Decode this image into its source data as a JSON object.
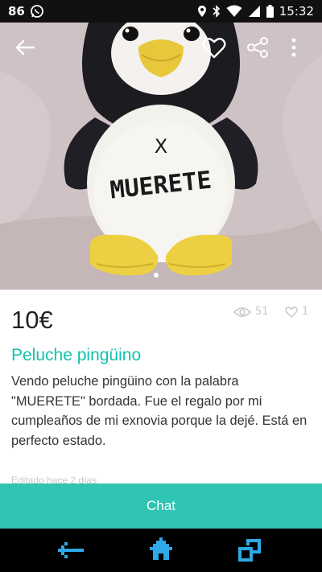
{
  "status_bar": {
    "notification_count": "86",
    "time": "15:32",
    "icons": [
      "whatsapp-icon",
      "location-icon",
      "bluetooth-icon",
      "wifi-icon",
      "signal-icon",
      "battery-icon"
    ]
  },
  "toolbar": {
    "icons": [
      "back-arrow-icon",
      "heart-icon",
      "share-icon",
      "more-vertical-icon"
    ]
  },
  "photo": {
    "embroidery_mark": "X",
    "embroidery_text": "MUERETE"
  },
  "listing": {
    "price": "10€",
    "views": "51",
    "favorites": "1",
    "title": "Peluche pingüino",
    "description": "Vendo peluche pingüino con la palabra \"MUERETE\" bordada. Fue el regalo por mi cumpleaños de mi exnovia porque la dejé. Está en perfecto estado.",
    "edited": "Editado hace 2 días"
  },
  "actions": {
    "chat_label": "Chat"
  },
  "colors": {
    "accent": "#13c1ac",
    "chat_button": "#2fc4b3",
    "status_bar": "#111111"
  },
  "nav_bar": {
    "icons": [
      "back-nav-icon",
      "home-nav-icon",
      "recents-nav-icon"
    ]
  }
}
